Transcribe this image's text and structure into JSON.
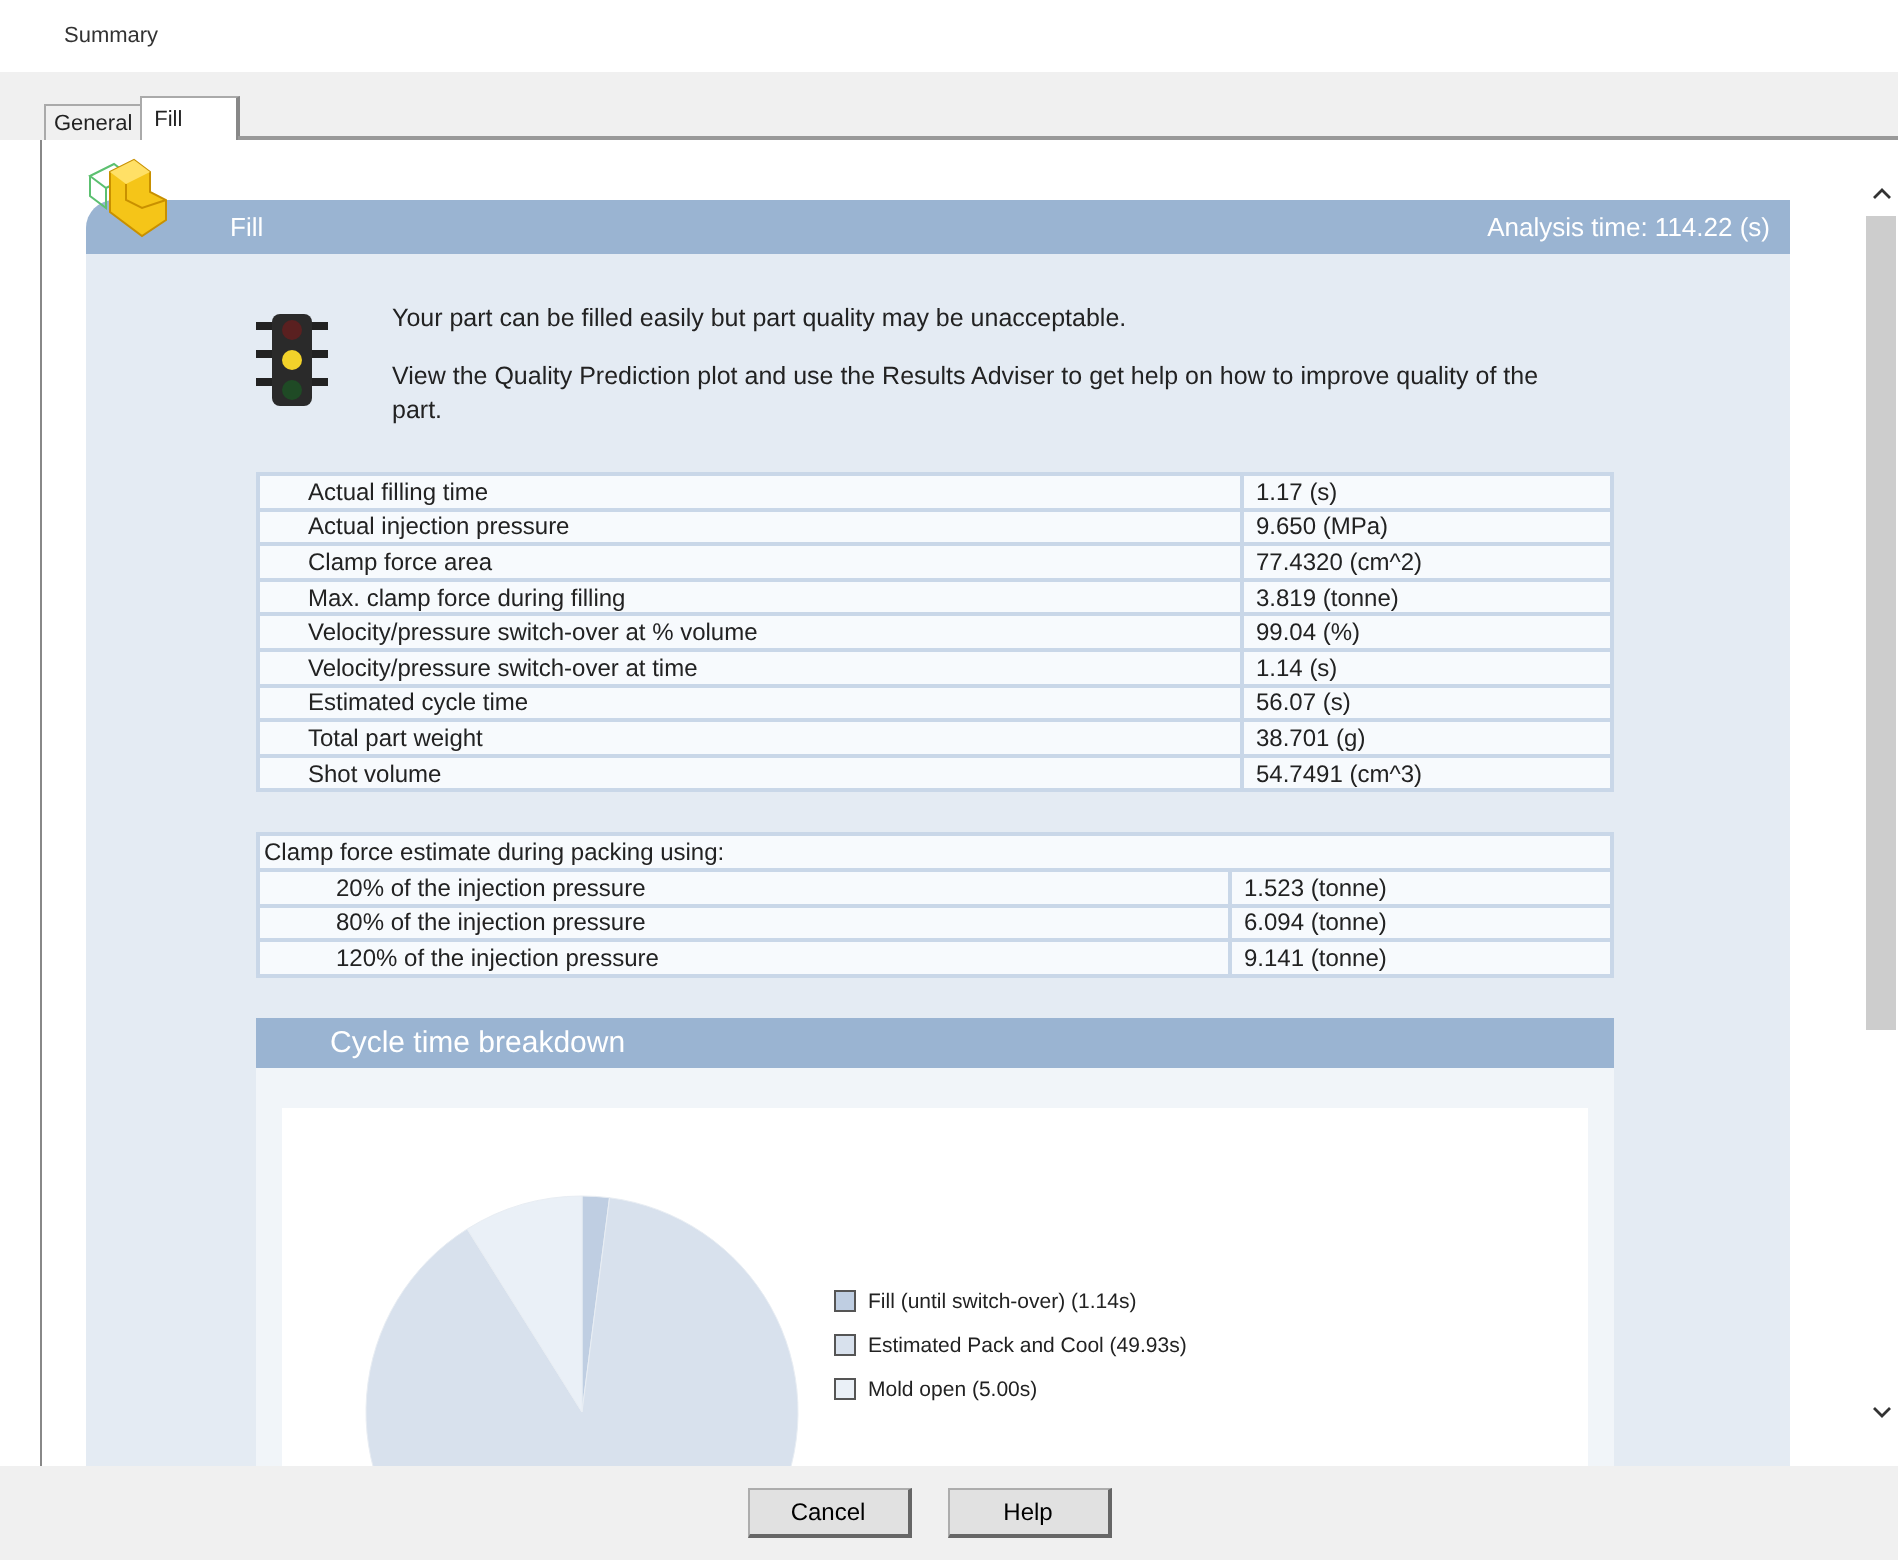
{
  "window": {
    "title": "Summary"
  },
  "tabs": [
    {
      "label": "General",
      "selected": false
    },
    {
      "label": "Fill",
      "selected": true
    }
  ],
  "card": {
    "title": "Fill",
    "analysis_time": "Analysis time: 114.22 (s)"
  },
  "message": {
    "kind": "warning",
    "lines": [
      "Your part can be filled easily but part quality may be unacceptable.",
      "View the Quality Prediction plot and use the Results Adviser to get help on how to improve quality of the part."
    ]
  },
  "results": [
    {
      "label": "Actual filling time",
      "value": "1.17 (s)"
    },
    {
      "label": "Actual injection pressure",
      "value": "9.650 (MPa)"
    },
    {
      "label": "Clamp force area",
      "value": "77.4320 (cm^2)"
    },
    {
      "label": "Max. clamp force during filling",
      "value": "3.819 (tonne)"
    },
    {
      "label": "Velocity/pressure switch-over at % volume",
      "value": "99.04 (%)"
    },
    {
      "label": "Velocity/pressure switch-over at time",
      "value": "1.14 (s)"
    },
    {
      "label": "Estimated cycle time",
      "value": "56.07 (s)"
    },
    {
      "label": "Total part weight",
      "value": "38.701 (g)"
    },
    {
      "label": "Shot volume",
      "value": "54.7491 (cm^3)"
    }
  ],
  "clamp": {
    "heading": "Clamp force estimate during packing using:",
    "rows": [
      {
        "label": "20% of the injection pressure",
        "value": "1.523 (tonne)"
      },
      {
        "label": "80% of the injection pressure",
        "value": "6.094 (tonne)"
      },
      {
        "label": "120% of the injection pressure",
        "value": "9.141 (tonne)"
      }
    ]
  },
  "cycle": {
    "heading": "Cycle time breakdown",
    "chart_data": {
      "type": "pie",
      "categories": [
        "Fill (until switch-over) (1.14s)",
        "Estimated Pack and Cool (49.93s)",
        "Mold open (5.00s)"
      ],
      "values": [
        1.14,
        49.93,
        5.0
      ],
      "legend": "right"
    }
  },
  "buttons": [
    "Cancel",
    "Help"
  ]
}
